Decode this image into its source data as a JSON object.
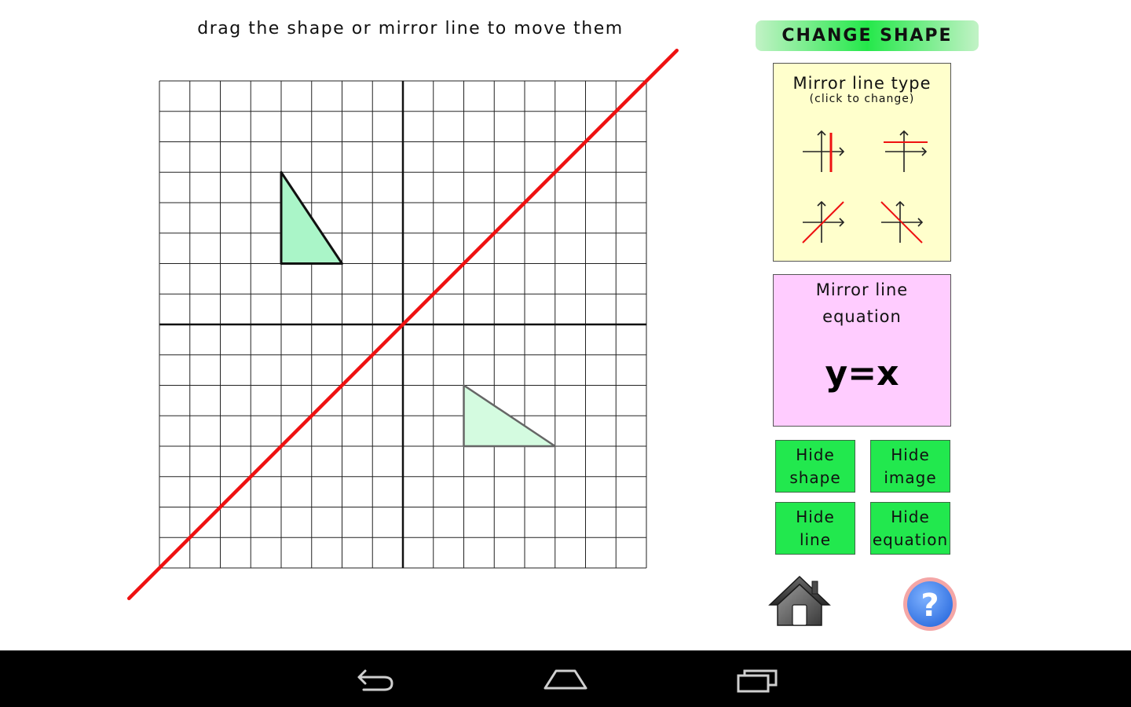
{
  "instruction": "drag the shape or mirror line to move them",
  "change_shape_label": "CHANGE SHAPE",
  "mirror_type_panel": {
    "title": "Mirror line type",
    "subtitle": "(click to change)",
    "options": [
      "vertical",
      "horizontal",
      "diagonal-up",
      "diagonal-down"
    ]
  },
  "equation_panel": {
    "title_line1": "Mirror line",
    "title_line2": "equation",
    "equation": "y=x"
  },
  "buttons": {
    "hide_shape": [
      "Hide",
      "shape"
    ],
    "hide_image": [
      "Hide",
      "image"
    ],
    "hide_line": [
      "Hide",
      "line"
    ],
    "hide_equation": [
      "Hide",
      "equation"
    ]
  },
  "icons": {
    "home": "home-icon",
    "help": "help-icon",
    "help_glyph": "?",
    "nav_back": "back-icon",
    "nav_home": "nav-home-icon",
    "nav_recents": "recent-apps-icon"
  },
  "colors": {
    "grid": "#222222",
    "mirror_line": "#ee1111",
    "shape_fill": "#aaf5c8",
    "image_fill": "#d4fbe0",
    "button_green": "#22e84e",
    "type_panel": "#ffffcc",
    "eq_panel": "#ffccff",
    "help_blue": "#4f8ff0",
    "help_ring": "#f2a0a0"
  },
  "grid": {
    "x_range": [
      -8,
      8
    ],
    "y_range": [
      -8,
      8
    ],
    "mirror_line": {
      "from": [
        -9,
        -9
      ],
      "to": [
        9,
        9
      ]
    },
    "shape": [
      [
        -4,
        5
      ],
      [
        -4,
        2
      ],
      [
        -2,
        2
      ]
    ],
    "image": [
      [
        2,
        -2
      ],
      [
        2,
        -4
      ],
      [
        5,
        -4
      ]
    ]
  }
}
